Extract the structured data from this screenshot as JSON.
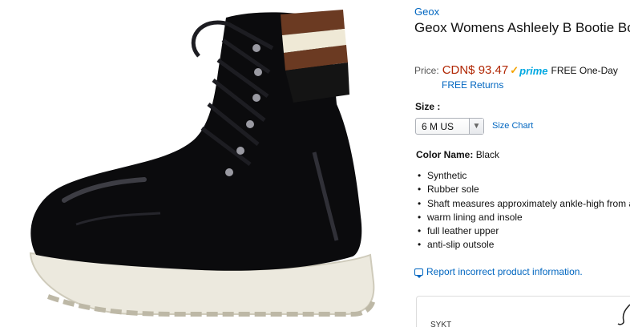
{
  "product": {
    "brand": "Geox",
    "title": "Geox Womens Ashleely B Bootie Bootie",
    "price_label": "Price:",
    "price": "CDN$ 93.47",
    "prime_label": "prime",
    "shipping": "FREE One-Day",
    "returns": "FREE Returns",
    "size_label": "Size :",
    "size_selected": "6 M US",
    "size_chart": "Size Chart",
    "color_label": "Color Name:",
    "color_value": "Black",
    "features": [
      "Synthetic",
      "Rubber sole",
      "Shaft measures approximately ankle-high from arch",
      "warm lining and insole",
      "full leather upper",
      "anti-slip outsole"
    ],
    "report_link": "Report incorrect product information.",
    "bottom_text": "SYKT"
  },
  "colors": {
    "link": "#0066c0",
    "price": "#b12704",
    "prime": "#00a8e1"
  },
  "icons": [
    "prime-check-icon",
    "dropdown-arrow-icon",
    "report-icon"
  ]
}
